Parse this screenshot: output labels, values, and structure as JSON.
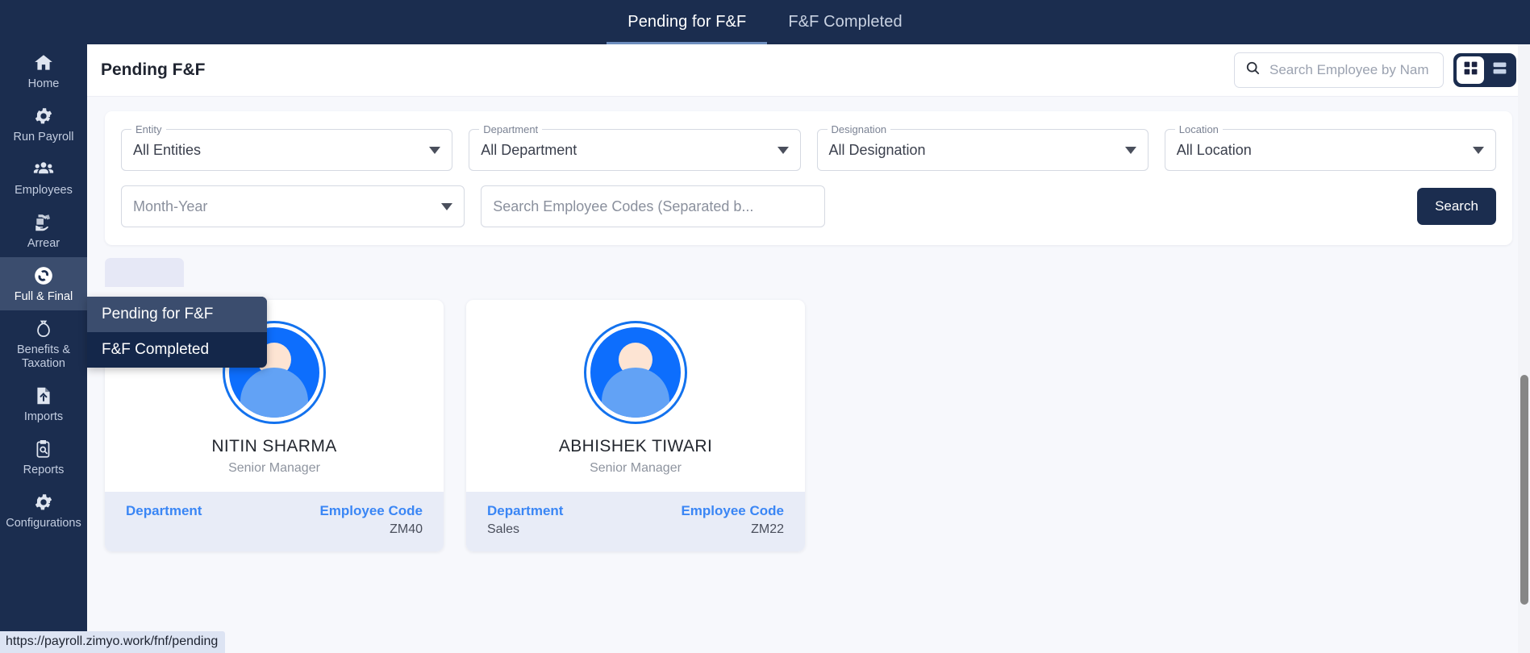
{
  "topbar": {
    "tabs": [
      {
        "label": "Pending for F&F",
        "active": true
      },
      {
        "label": "F&F Completed",
        "active": false
      }
    ]
  },
  "sidebar": {
    "items": [
      {
        "label": "Home",
        "icon": "home-icon",
        "active": false
      },
      {
        "label": "Run Payroll",
        "icon": "gear-icon",
        "active": false
      },
      {
        "label": "Employees",
        "icon": "people-icon",
        "active": false
      },
      {
        "label": "Arrear",
        "icon": "cash-hand-icon",
        "active": false
      },
      {
        "label": "Full & Final",
        "icon": "refresh-circle-icon",
        "active": true
      },
      {
        "label": "Benefits & Taxation",
        "icon": "moneybag-icon",
        "active": false
      },
      {
        "label": "Imports",
        "icon": "file-upload-icon",
        "active": false
      },
      {
        "label": "Reports",
        "icon": "clipboard-search-icon",
        "active": false
      },
      {
        "label": "Configurations",
        "icon": "gear-icon",
        "active": false
      }
    ]
  },
  "header": {
    "title": "Pending F&F",
    "search_placeholder": "Search Employee by Nam",
    "search_value": "",
    "view_toggle": {
      "grid_label": "grid-view",
      "list_label": "list-view",
      "active": "grid"
    }
  },
  "filters": {
    "entity": {
      "label": "Entity",
      "value": "All Entities"
    },
    "department": {
      "label": "Department",
      "value": "All Department"
    },
    "designation": {
      "label": "Designation",
      "value": "All Designation"
    },
    "location": {
      "label": "Location",
      "value": "All Location"
    },
    "month_year": {
      "label": "",
      "value": "Month-Year"
    },
    "employee_codes": {
      "label": "",
      "placeholder": "Search Employee Codes (Separated b...",
      "value": ""
    },
    "search_button": "Search"
  },
  "tab_chip": {
    "label": ""
  },
  "flyout": {
    "items": [
      {
        "label": "Pending for F&F",
        "hovered": true
      },
      {
        "label": "F&F Completed",
        "hovered": false
      }
    ]
  },
  "cards": [
    {
      "name": "NITIN SHARMA",
      "role": "Senior Manager",
      "department_label": "Department",
      "department_value": "",
      "code_label": "Employee Code",
      "code_value": "ZM40"
    },
    {
      "name": "ABHISHEK TIWARI",
      "role": "Senior Manager",
      "department_label": "Department",
      "department_value": "Sales",
      "code_label": "Employee Code",
      "code_value": "ZM22"
    }
  ],
  "statusbar": {
    "url": "https://payroll.zimyo.work/fnf/pending"
  },
  "colors": {
    "navy": "#1b2d4f",
    "navy_dark": "#14274a",
    "accent_blue": "#3a86f5",
    "avatar_blue": "#0d6efd",
    "chip_lavender": "#e6e8f6",
    "page_bg": "#f7f8fc"
  }
}
